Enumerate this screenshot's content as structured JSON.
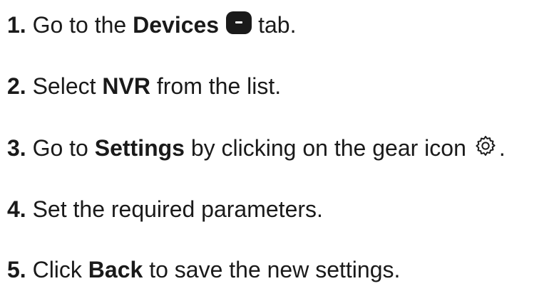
{
  "steps": [
    {
      "number": "1.",
      "pre": "Go to the",
      "bold": "Devices",
      "post": "tab.",
      "icon": "devices-icon"
    },
    {
      "number": "2.",
      "pre": "Select",
      "bold": "NVR",
      "post": "from the list."
    },
    {
      "number": "3.",
      "pre": "Go to",
      "bold": "Settings",
      "post": "by clicking on the gear icon",
      "icon": "gear-icon",
      "tail": "."
    },
    {
      "number": "4.",
      "pre": "Set the required parameters."
    },
    {
      "number": "5.",
      "pre": "Click",
      "bold": "Back",
      "post": "to save the new settings."
    }
  ]
}
